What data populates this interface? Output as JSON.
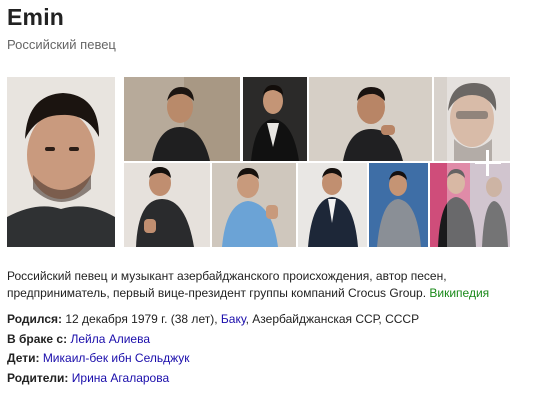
{
  "header": {
    "title": "Emin",
    "subtitle": "Российский певец"
  },
  "gallery": {
    "more_icon": "plus-icon"
  },
  "description": {
    "text": "Российский певец и музыкант азербайджанского происхождения, автор песен, предприниматель, первый вице-президент группы компаний Crocus Group.",
    "source_link": "Википедия"
  },
  "facts": {
    "born": {
      "label": "Родился:",
      "date": "12 декабря 1979 г. (38 лет),",
      "city_link": "Баку",
      "place_rest": ", Азербайджанская ССР, СССР"
    },
    "spouse": {
      "label": "В браке с:",
      "value_link": "Лейла Алиева"
    },
    "children": {
      "label": "Дети:",
      "value_link": "Микаил-бек ибн Сельджук"
    },
    "parents": {
      "label": "Родители:",
      "value_link": "Ирина Агаларова"
    }
  },
  "colors": {
    "link_blue": "#1a0dab",
    "wiki_green": "#1a8a1a"
  }
}
